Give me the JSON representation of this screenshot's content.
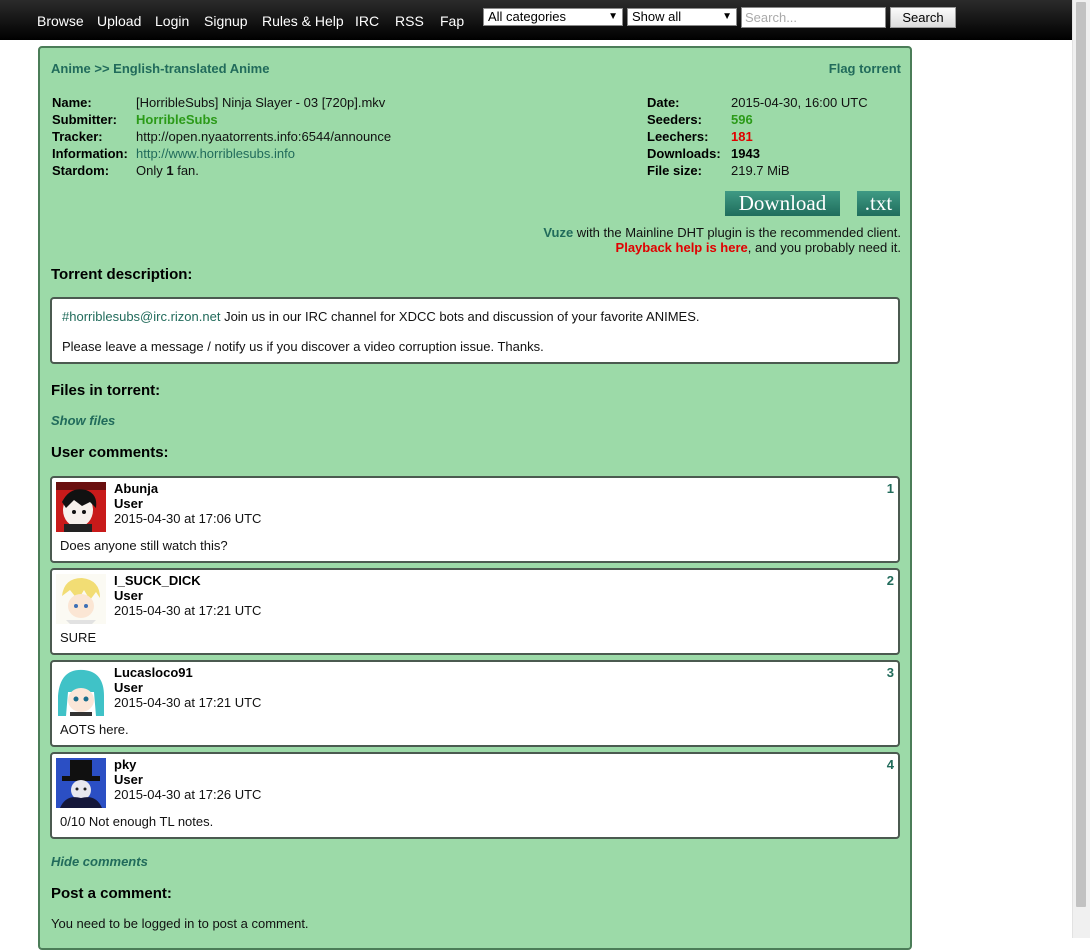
{
  "nav": {
    "browse": "Browse",
    "upload": "Upload",
    "login": "Login",
    "signup": "Signup",
    "rules": "Rules & Help",
    "irc": "IRC",
    "rss": "RSS",
    "fap": "Fap"
  },
  "filters": {
    "category_selected": "All categories",
    "show_selected": "Show all",
    "search_placeholder": "Search...",
    "search_button": "Search"
  },
  "breadcrumb": {
    "category": "Anime",
    "separator": ">>",
    "subcategory": "English-translated Anime",
    "flag": "Flag torrent"
  },
  "info": {
    "name_label": "Name:",
    "name": "[HorribleSubs] Ninja Slayer - 03 [720p].mkv",
    "submitter_label": "Submitter:",
    "submitter": "HorribleSubs",
    "tracker_label": "Tracker:",
    "tracker": "http://open.nyaatorrents.info:6544/announce",
    "information_label": "Information:",
    "information": "http://www.horriblesubs.info",
    "stardom_label": "Stardom:",
    "stardom_pre": "Only",
    "stardom_count": "1",
    "stardom_post": "fan.",
    "date_label": "Date:",
    "date": "2015-04-30, 16:00 UTC",
    "seeders_label": "Seeders:",
    "seeders": "596",
    "leechers_label": "Leechers:",
    "leechers": "181",
    "downloads_label": "Downloads:",
    "downloads": "1943",
    "filesize_label": "File size:",
    "filesize": "219.7 MiB"
  },
  "download": {
    "download_label": "Download",
    "txt_label": ".txt",
    "client_name": "Vuze",
    "client_text": "with the Mainline DHT plugin is the recommended client.",
    "playback_link": "Playback help is here",
    "playback_text": ", and you probably need it."
  },
  "description": {
    "heading": "Torrent description:",
    "irc_link": "#horriblesubs@irc.rizon.net",
    "line1": "Join us in our IRC channel for XDCC bots and discussion of your favorite ANIMES.",
    "line2": "Please leave a message / notify us if you discover a video corruption issue. Thanks."
  },
  "files": {
    "heading": "Files in torrent:",
    "show_files": "Show files"
  },
  "comments": {
    "heading": "User comments:",
    "items": [
      {
        "user": "Abunja",
        "role": "User",
        "date": "2015-04-30 at 17:06 UTC",
        "num": "1",
        "text": "Does anyone still watch this?"
      },
      {
        "user": "I_SUCK_DICK",
        "role": "User",
        "date": "2015-04-30 at 17:21 UTC",
        "num": "2",
        "text": "SURE"
      },
      {
        "user": "Lucasloco91",
        "role": "User",
        "date": "2015-04-30 at 17:21 UTC",
        "num": "3",
        "text": "AOTS here."
      },
      {
        "user": "pky",
        "role": "User",
        "date": "2015-04-30 at 17:26 UTC",
        "num": "4",
        "text": "0/10 Not enough TL notes."
      }
    ],
    "hide_comments": "Hide comments"
  },
  "post": {
    "heading": "Post a comment:",
    "notice": "You need to be logged in to post a comment."
  },
  "colors": {
    "panel_bg": "#9cdaa8",
    "link_teal": "#216b5b",
    "submitter_green": "#2b9a18",
    "leechers_red": "#e00000"
  }
}
